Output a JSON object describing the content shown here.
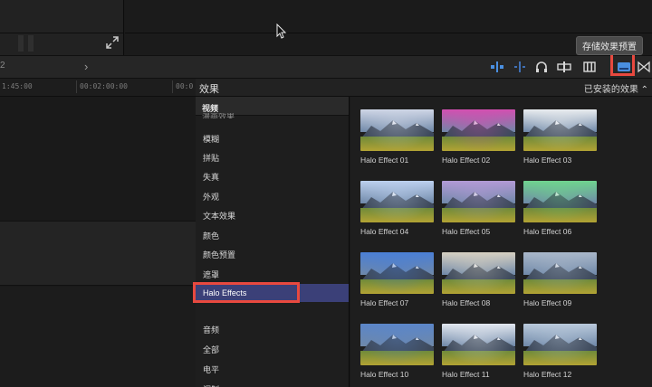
{
  "toolbar": {
    "timecode_fragment": "2",
    "tooltip": "存储效果预置"
  },
  "timeline": {
    "ruler": [
      "1:45:00",
      "00:02:00:00",
      "00:0"
    ]
  },
  "effects_browser": {
    "title": "效果",
    "filter": "已安装的效果 ⌃",
    "section_header": "视频",
    "clipped_item": "漫画效果",
    "categories": [
      "模糊",
      "拼贴",
      "失真",
      "外观",
      "文本效果",
      "颜色",
      "颜色预置",
      "遮罩",
      "Halo Effects"
    ],
    "audio_categories": [
      "音频",
      "全部",
      "电平",
      "调制"
    ],
    "selected_category": "Halo Effects",
    "effects": [
      {
        "label": "Halo Effect 01",
        "tint": "#cfd6e6"
      },
      {
        "label": "Halo Effect 02",
        "tint": "#d34fb1"
      },
      {
        "label": "Halo Effect 03",
        "tint": "#e9ecef"
      },
      {
        "label": "Halo Effect 04",
        "tint": "#bcd0ee"
      },
      {
        "label": "Halo Effect 05",
        "tint": "#b29ad6"
      },
      {
        "label": "Halo Effect 06",
        "tint": "#6fd38e"
      },
      {
        "label": "Halo Effect 07",
        "tint": "#4a7fd6"
      },
      {
        "label": "Halo Effect 08",
        "tint": "#d6d0c2"
      },
      {
        "label": "Halo Effect 09",
        "tint": "#a9b7c9"
      },
      {
        "label": "Halo Effect 10",
        "tint": "#5b86c9"
      },
      {
        "label": "Halo Effect 11",
        "tint": "#e2e7ef"
      },
      {
        "label": "Halo Effect 12",
        "tint": "#b9c9db"
      }
    ]
  },
  "colors": {
    "selection": "#3b4078",
    "highlight": "#e8493f",
    "accent": "#4a8fe0"
  }
}
